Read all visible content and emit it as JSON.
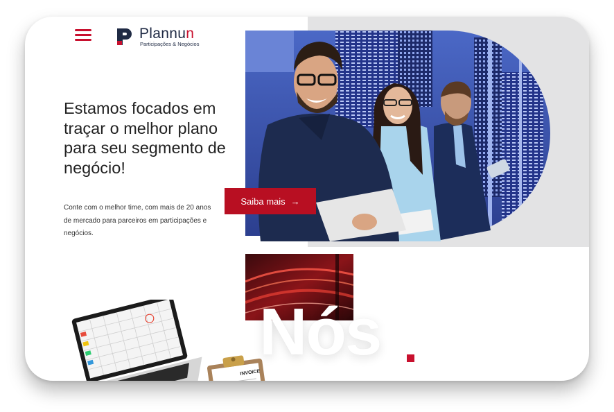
{
  "brand": {
    "name_main": "Plannu",
    "name_accent": "n",
    "tagline": "Participações & Negócios",
    "accent_color": "#c8102e",
    "navy_color": "#1f2a44"
  },
  "header": {
    "menu_icon": "hamburger-menu-icon"
  },
  "hero": {
    "headline": "Estamos focados em traçar o melhor plano para seu segmento de negócio!",
    "subtext": "Conte com o melhor time, com mais de 20 anos de mercado para parceiros em participações e negócios.",
    "cta_label": "Saiba mais",
    "cta_icon": "arrow-right-icon",
    "cta_arrow": "→"
  },
  "about": {
    "title": "Nós",
    "title_dot": "."
  },
  "decor": {
    "invoice_label": "INVOICE"
  }
}
